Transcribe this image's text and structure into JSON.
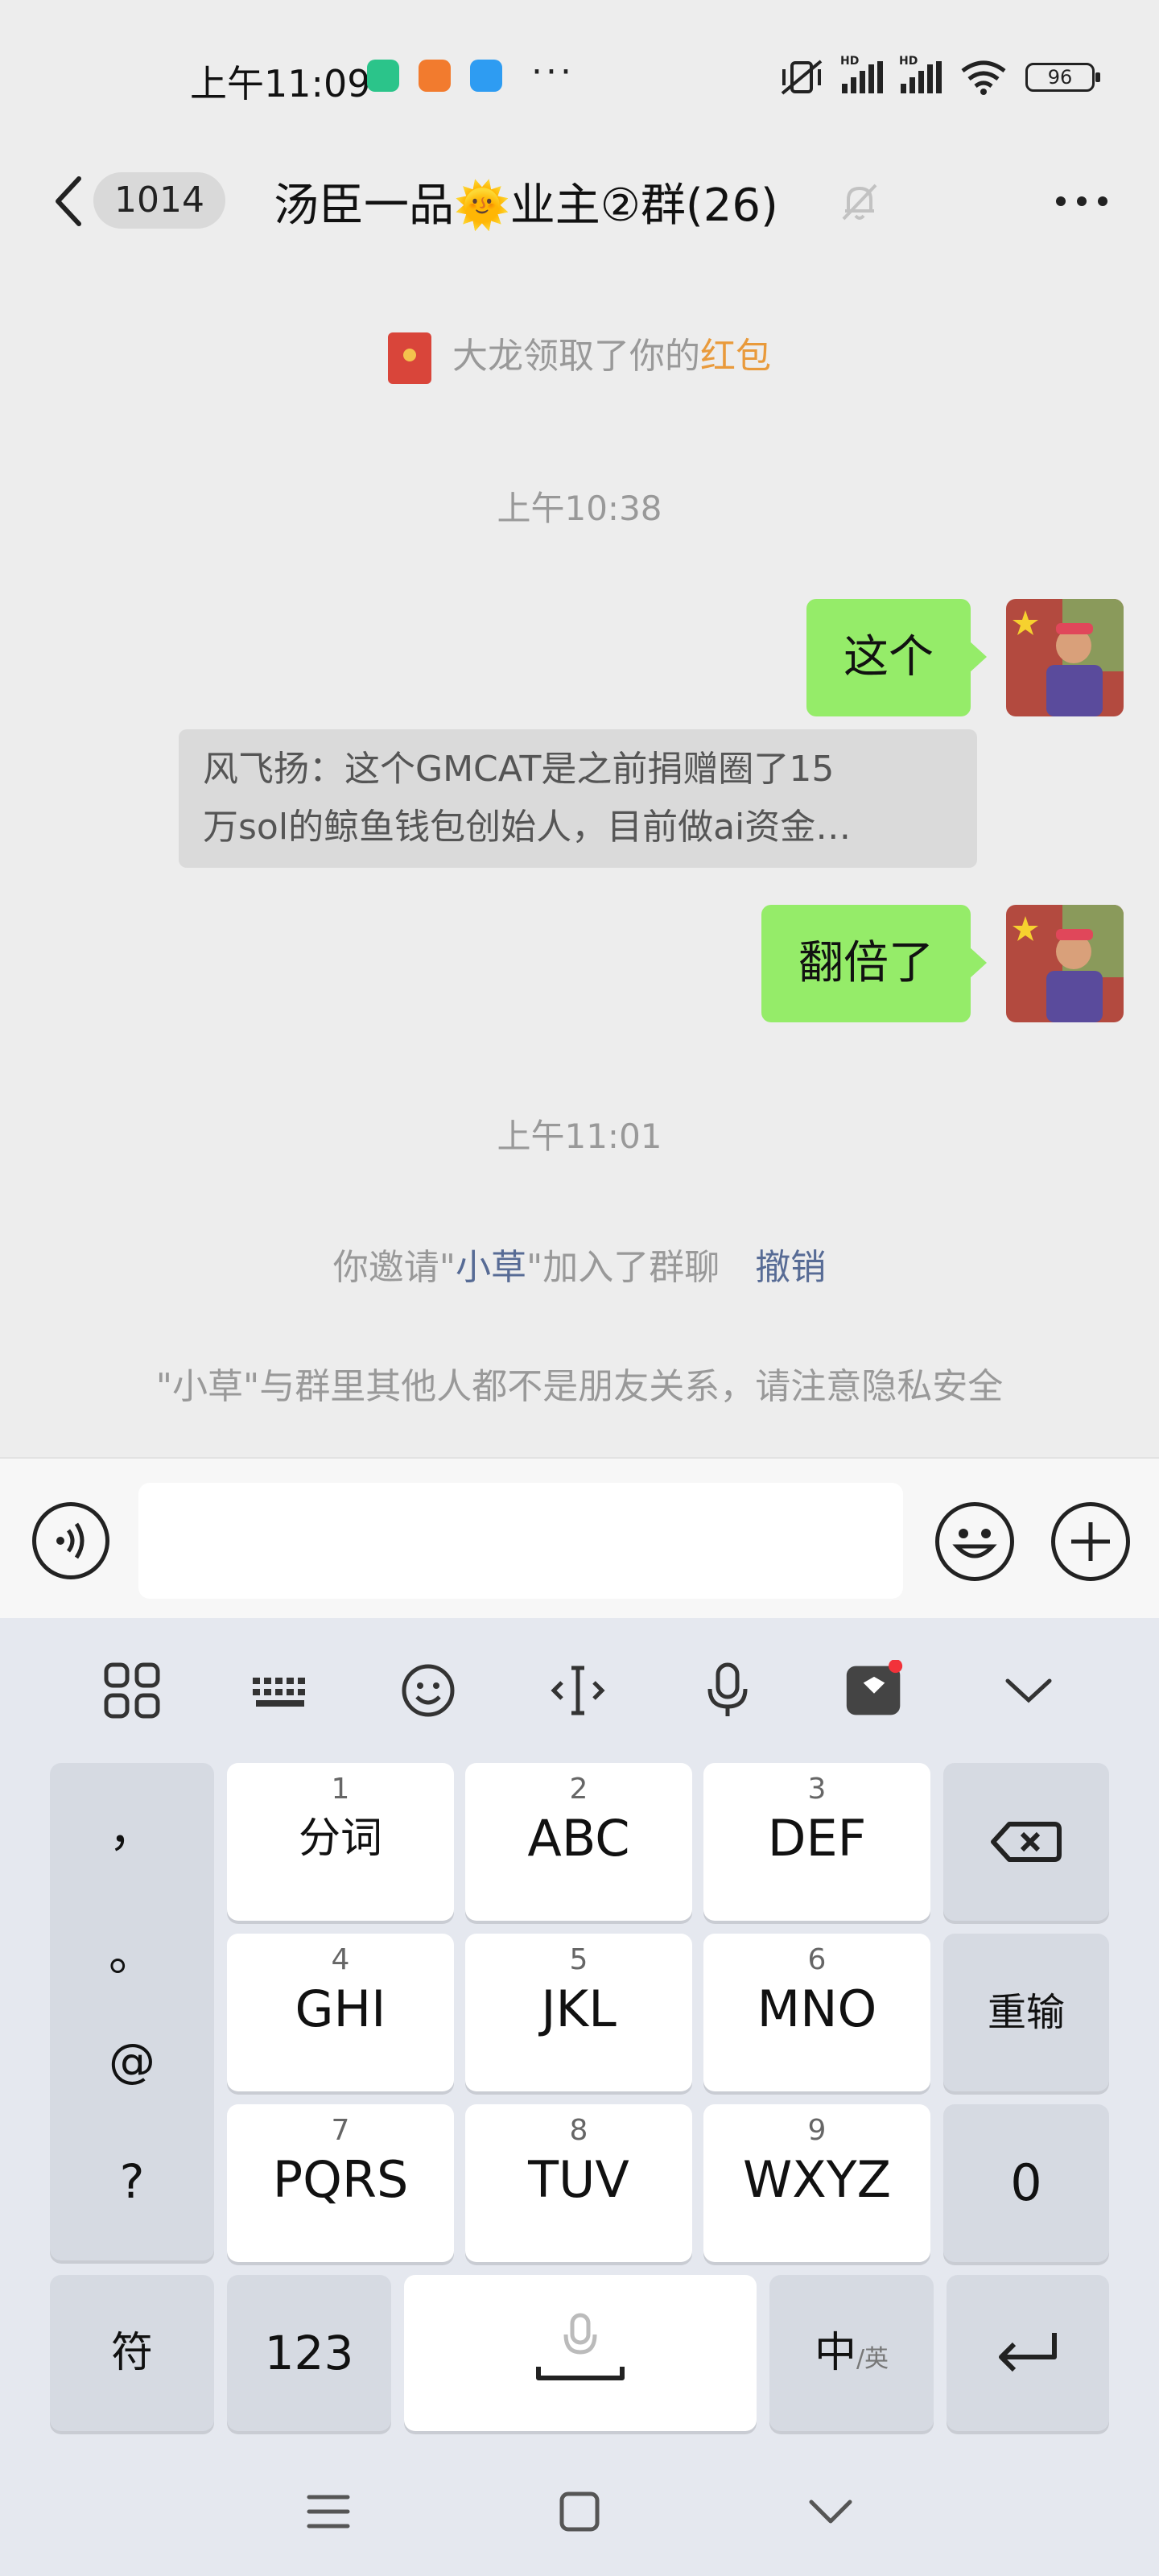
{
  "status_bar": {
    "time": "上午11:09",
    "more": "···",
    "signal_labels": [
      "HD",
      "HD"
    ],
    "battery": "96"
  },
  "header": {
    "unread_count": "1014",
    "title": "汤臣一品🌞业主②群(26)"
  },
  "chat": {
    "redpacket_prefix": "大龙领取了你的",
    "redpacket_link": "红包",
    "time_1": "上午10:38",
    "msg_1": "这个",
    "quote_line_1": "风飞扬：这个GMCAT是之前捐赠圈了15",
    "quote_line_2": "万sol的鲸鱼钱包创始人，目前做ai资金…",
    "msg_2": "翻倍了",
    "time_2": "上午11:01",
    "invite_prefix": "你邀请\"",
    "invite_name": "小草",
    "invite_suffix": "\"加入了群聊",
    "revoke": "撤销",
    "privacy_notice": "\"小草\"与群里其他人都不是朋友关系，请注意隐私安全"
  },
  "keyboard": {
    "punctuation": [
      "，",
      "。",
      "@",
      "?"
    ],
    "rows": [
      [
        {
          "num": "1",
          "label": "分词"
        },
        {
          "num": "2",
          "label": "ABC"
        },
        {
          "num": "3",
          "label": "DEF"
        }
      ],
      [
        {
          "num": "4",
          "label": "GHI"
        },
        {
          "num": "5",
          "label": "JKL"
        },
        {
          "num": "6",
          "label": "MNO"
        }
      ],
      [
        {
          "num": "7",
          "label": "PQRS"
        },
        {
          "num": "8",
          "label": "TUV"
        },
        {
          "num": "9",
          "label": "WXYZ"
        }
      ]
    ],
    "reenter": "重输",
    "zero": "0",
    "symbols": "符",
    "numbers": "123",
    "lang_main": "中",
    "lang_alt": "/英"
  },
  "colors": {
    "bubble_out": "#95ec69",
    "link_blue": "#576b95",
    "redpacket_orange": "#e99a3b"
  }
}
